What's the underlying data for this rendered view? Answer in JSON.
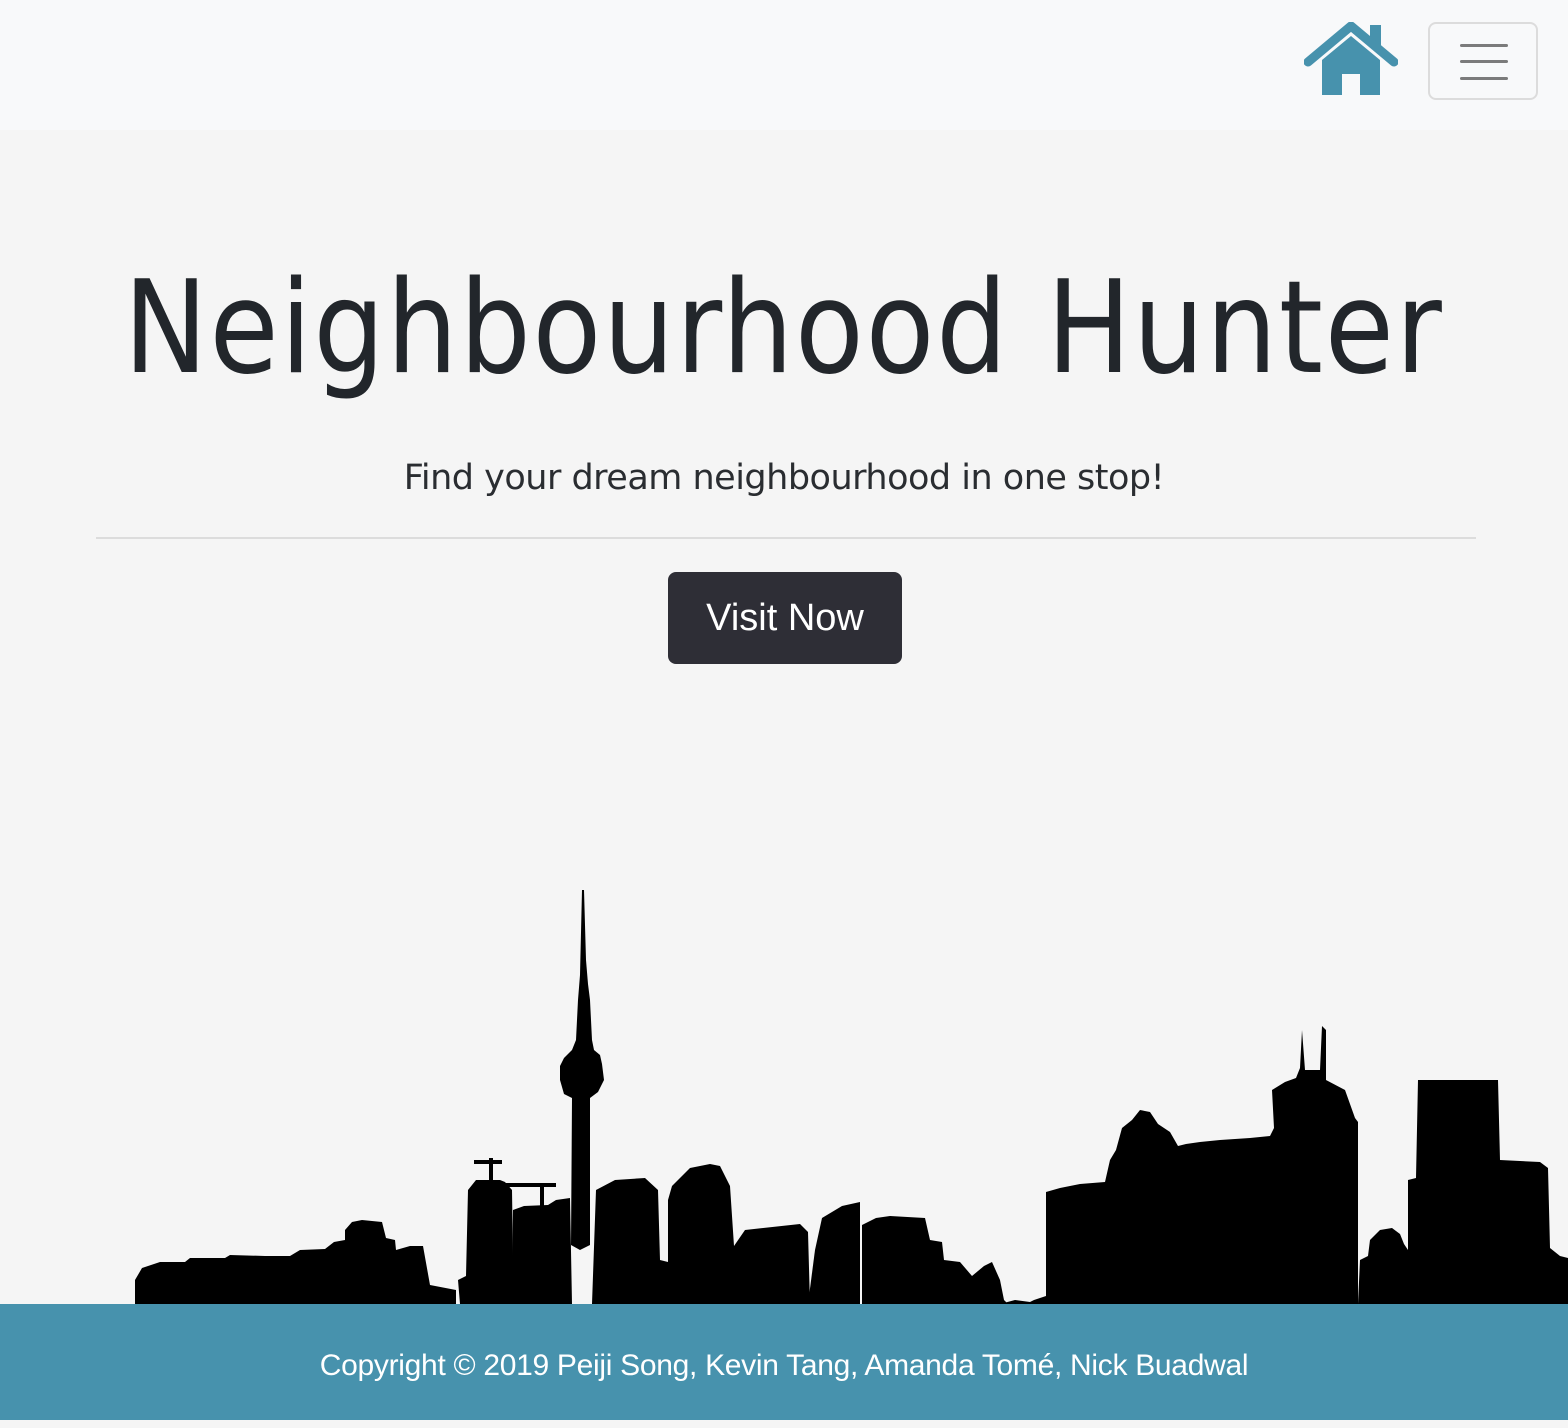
{
  "navbar": {
    "home_icon": "home-icon",
    "toggler_icon": "menu-icon",
    "toggler_label": "Toggle navigation"
  },
  "hero": {
    "title": "Neighbourhood Hunter",
    "subtitle": "Find your dream neighbourhood in one stop!",
    "cta_label": "Visit Now"
  },
  "skyline": {
    "image": "city-skyline-silhouette"
  },
  "footer": {
    "copyright": "Copyright © 2019 Peiji Song, Kevin Tang, Amanda Tomé, Nick Buadwal"
  },
  "colors": {
    "brand": "#4792ad",
    "button_bg": "#2e2e36",
    "page_bg": "#f5f5f5",
    "navbar_bg": "#f8f9fa"
  }
}
